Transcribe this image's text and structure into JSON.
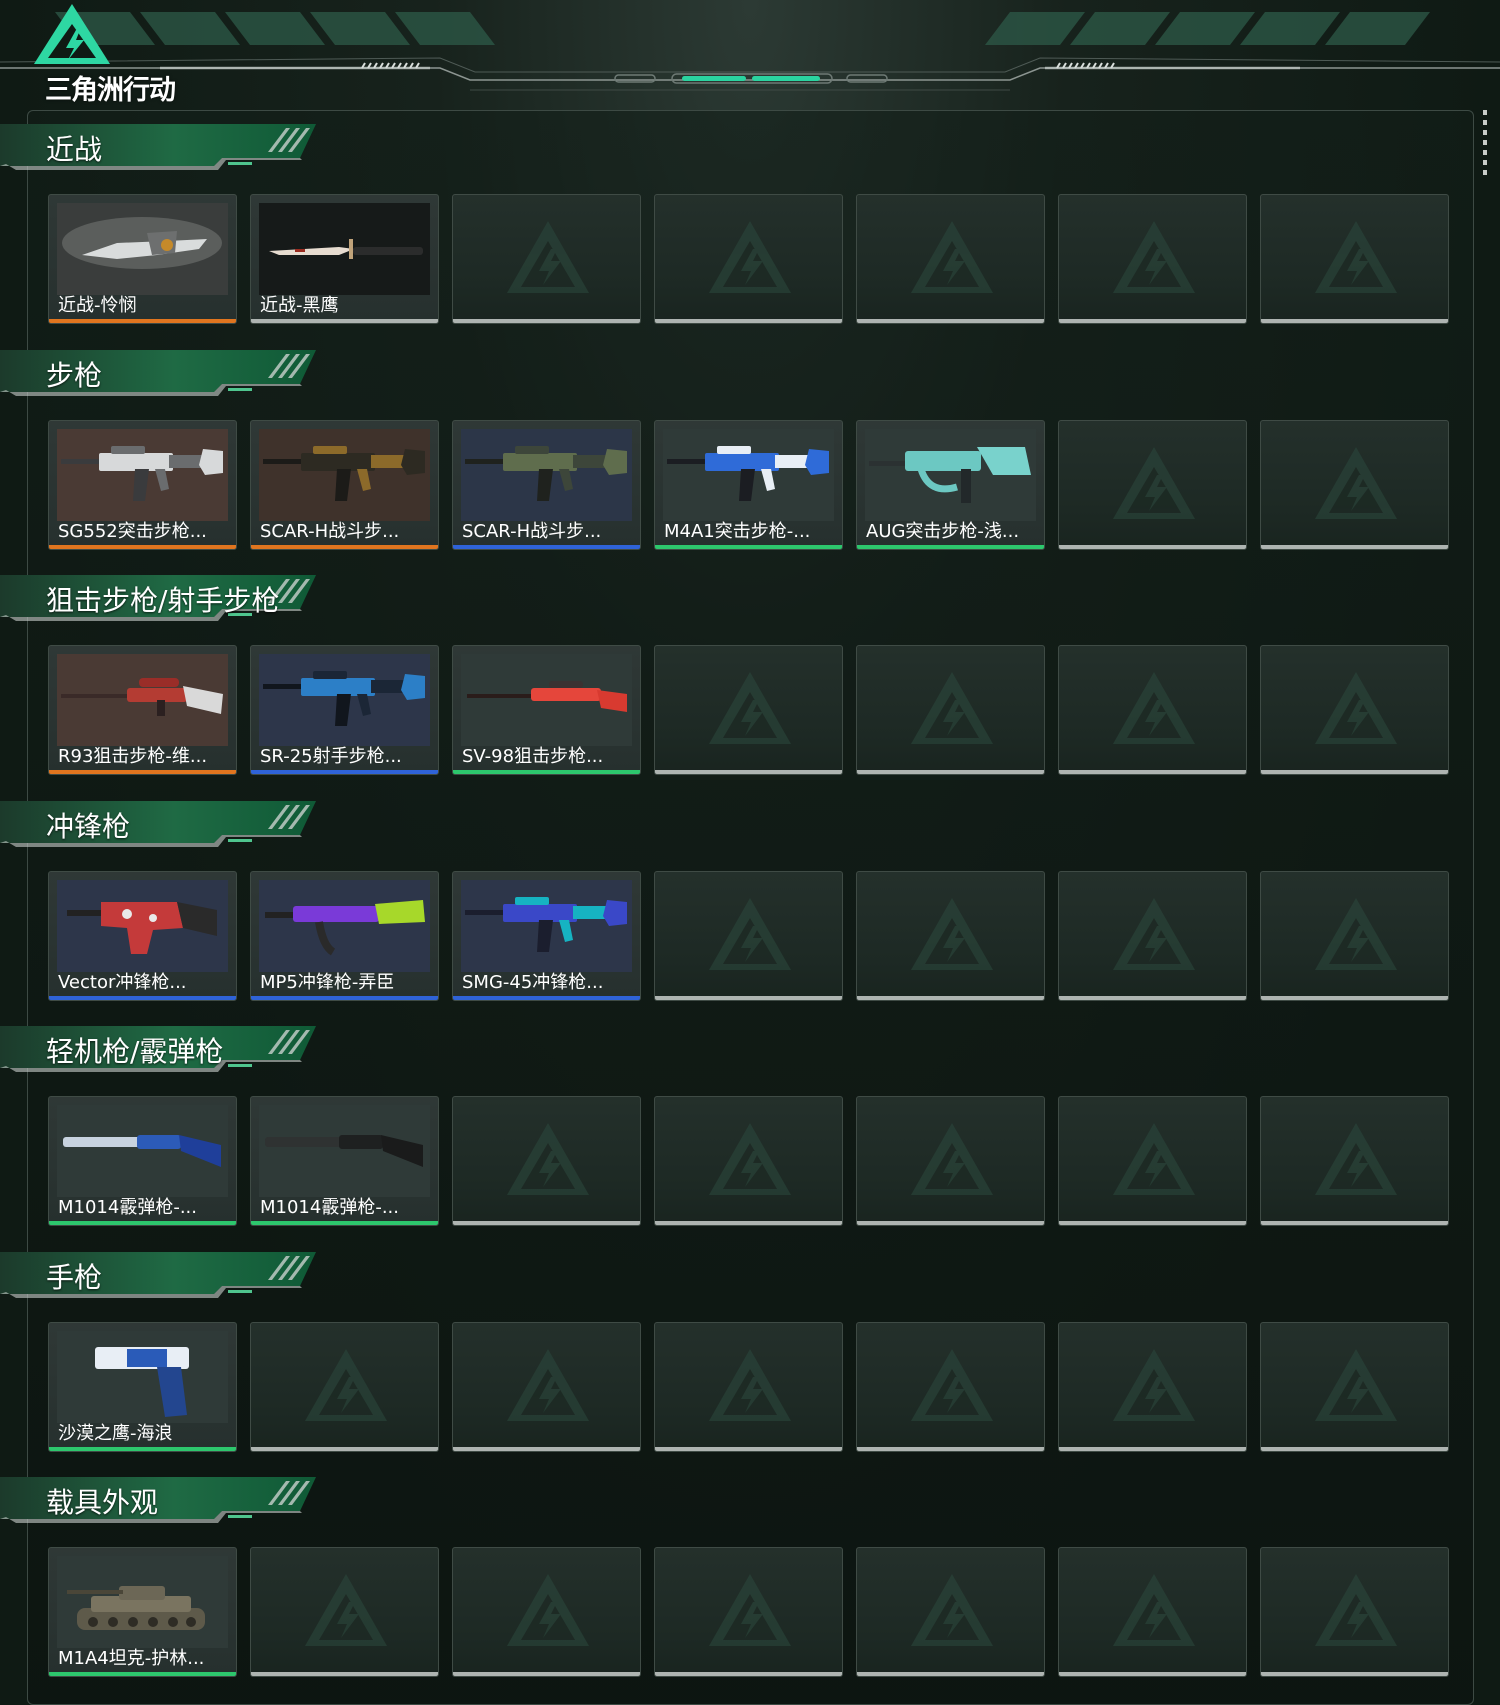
{
  "app": {
    "title": "三角洲行动"
  },
  "colors": {
    "accent": "#2fd3a0",
    "rarity_orange": "#e0751f",
    "rarity_blue": "#2f63d8",
    "rarity_green": "#2dc76d",
    "empty_bar": "#aeb4b1"
  },
  "sections": [
    {
      "title": "近战",
      "items": [
        {
          "label": "近战-怜悯",
          "rarity": "orange",
          "icon": "knife-mercy"
        },
        {
          "label": "近战-黑鹰",
          "rarity": "gray",
          "icon": "knife-blackhawk"
        }
      ]
    },
    {
      "title": "步枪",
      "items": [
        {
          "label": "SG552突击步枪...",
          "rarity": "orange",
          "icon": "rifle-sg552"
        },
        {
          "label": "SCAR-H战斗步...",
          "rarity": "orange",
          "icon": "rifle-scar-gold"
        },
        {
          "label": "SCAR-H战斗步...",
          "rarity": "blue",
          "icon": "rifle-scar-green"
        },
        {
          "label": "M4A1突击步枪-...",
          "rarity": "green",
          "icon": "rifle-m4a1"
        },
        {
          "label": "AUG突击步枪-浅...",
          "rarity": "green",
          "icon": "rifle-aug"
        }
      ]
    },
    {
      "title": "狙击步枪/射手步枪",
      "items": [
        {
          "label": "R93狙击步枪-维...",
          "rarity": "orange",
          "icon": "sniper-r93"
        },
        {
          "label": "SR-25射手步枪...",
          "rarity": "blue",
          "icon": "marksman-sr25"
        },
        {
          "label": "SV-98狙击步枪...",
          "rarity": "green",
          "icon": "sniper-sv98"
        }
      ]
    },
    {
      "title": "冲锋枪",
      "items": [
        {
          "label": "Vector冲锋枪...",
          "rarity": "blue",
          "icon": "smg-vector"
        },
        {
          "label": "MP5冲锋枪-弄臣",
          "rarity": "blue",
          "icon": "smg-mp5"
        },
        {
          "label": "SMG-45冲锋枪...",
          "rarity": "blue",
          "icon": "smg-45"
        }
      ]
    },
    {
      "title": "轻机枪/霰弹枪",
      "items": [
        {
          "label": "M1014霰弹枪-...",
          "rarity": "green",
          "icon": "shotgun-m1014-blue"
        },
        {
          "label": "M1014霰弹枪-...",
          "rarity": "green",
          "icon": "shotgun-m1014-black"
        }
      ]
    },
    {
      "title": "手枪",
      "items": [
        {
          "label": "沙漠之鹰-海浪",
          "rarity": "green",
          "icon": "pistol-deagle"
        }
      ]
    },
    {
      "title": "载具外观",
      "items": [
        {
          "label": "M1A4坦克-护林...",
          "rarity": "green",
          "icon": "tank-m1a4"
        }
      ]
    }
  ]
}
